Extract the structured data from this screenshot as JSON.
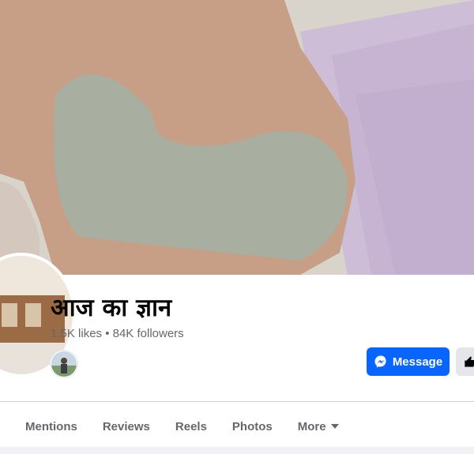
{
  "page": {
    "title": "आज का ज्ञान",
    "stats": "1.5K likes • 84K followers"
  },
  "actions": {
    "message_label": "Message"
  },
  "tabs": [
    {
      "label": "Mentions"
    },
    {
      "label": "Reviews"
    },
    {
      "label": "Reels"
    },
    {
      "label": "Photos"
    },
    {
      "label": "More"
    }
  ],
  "colors": {
    "primary_button": "#0866ff",
    "secondary_button": "#e4e6eb",
    "title_text": "#050505",
    "secondary_text": "#65676b"
  },
  "icons": {
    "message": "messenger-icon",
    "like": "thumbs-up-icon",
    "more_tab": "caret-down-icon"
  }
}
